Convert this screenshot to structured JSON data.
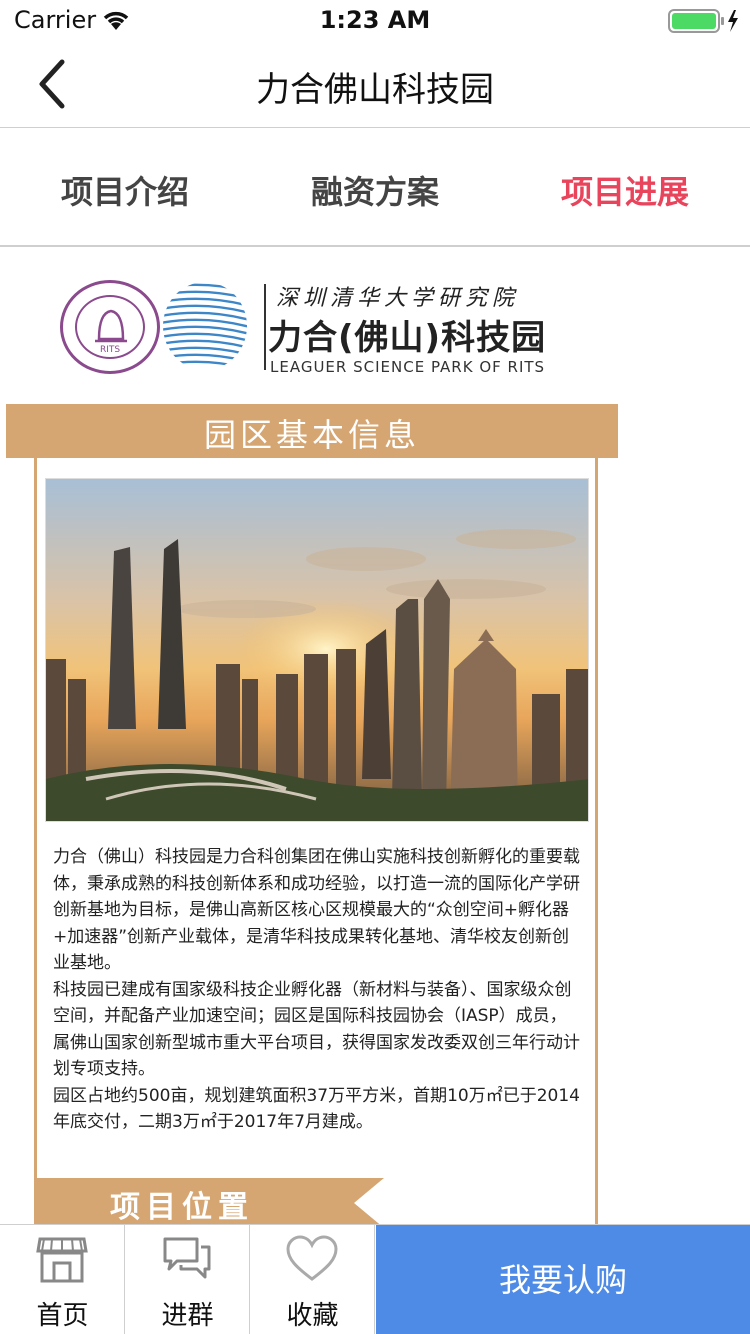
{
  "status_bar": {
    "carrier": "Carrier",
    "time": "1:23 AM"
  },
  "nav": {
    "title": "力合佛山科技园"
  },
  "tabs": [
    {
      "label": "项目介绍",
      "active": false
    },
    {
      "label": "融资方案",
      "active": false
    },
    {
      "label": "项目进展",
      "active": true
    }
  ],
  "colors": {
    "accent": "#e8445c",
    "banner": "#d5a572",
    "buy_button": "#4e8be6"
  },
  "logo": {
    "seal_text": "RITS",
    "calligraphy": "深圳清华大学研究院",
    "park_name_cn": "力合(佛山)科技园",
    "park_name_en": "LEAGUER SCIENCE PARK OF RITS"
  },
  "section": {
    "title": "园区基本信息",
    "paragraphs": [
      "力合（佛山）科技园是力合科创集团在佛山实施科技创新孵化的重要载体，秉承成熟的科技创新体系和成功经验，以打造一流的国际化产学研创新基地为目标，是佛山高新区核心区规模最大的“众创空间+孵化器+加速器”创新产业载体，是清华科技成果转化基地、清华校友创新创业基地。",
      "科技园已建成有国家级科技企业孵化器（新材料与装备）、国家级众创空间，并配备产业加速空间；园区是国际科技园协会（IASP）成员，属佛山国家创新型城市重大平台项目，获得国家发改委双创三年行动计划专项支持。",
      "园区占地约500亩，规划建筑面积37万平方米，首期10万㎡已于2014年底交付，二期3万㎡于2017年7月建成。"
    ]
  },
  "position_section": {
    "title": "项目位置"
  },
  "tabbar": {
    "items": [
      {
        "label": "首页",
        "icon": "store-icon"
      },
      {
        "label": "进群",
        "icon": "chat-icon"
      },
      {
        "label": "收藏",
        "icon": "heart-icon"
      }
    ],
    "buy_label": "我要认购"
  }
}
